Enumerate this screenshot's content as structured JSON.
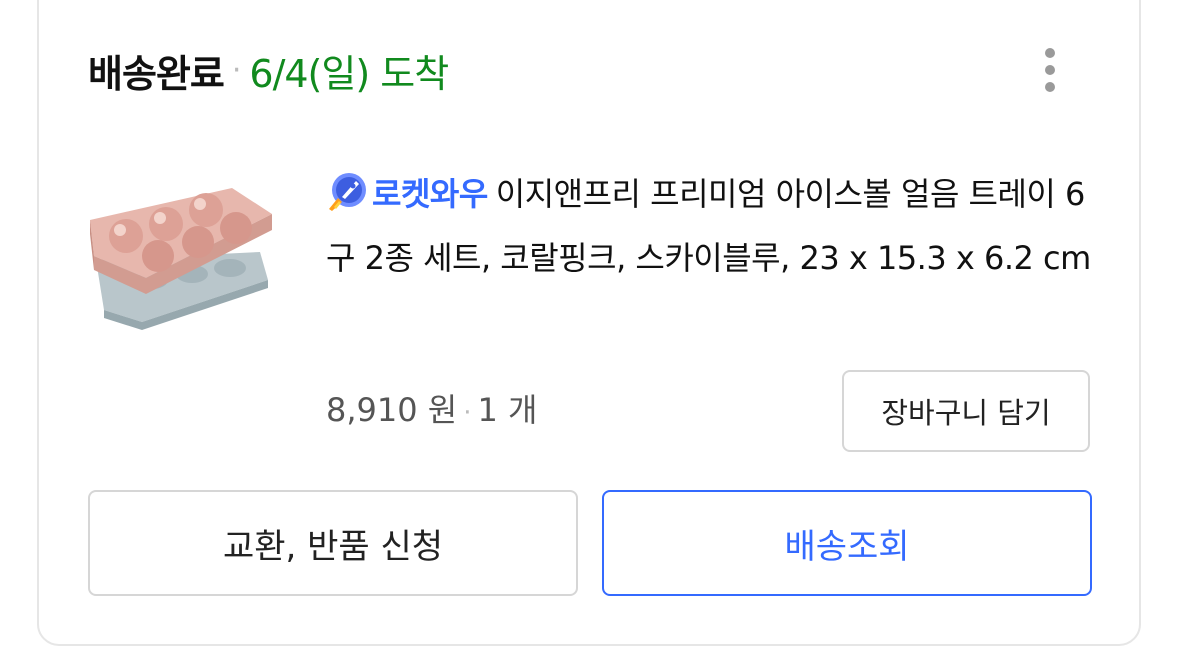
{
  "order": {
    "status": "배송완료",
    "separator": "·",
    "arrival": "6/4(일) 도착"
  },
  "product": {
    "badge_icon": "rocket-icon",
    "badge_label": "로켓와우",
    "title": "이지앤프리 프리미엄 아이스볼 얼음 트레이 6구 2종 세트, 코랄핑크, 스카이블루, 23 x 15.3 x 6.2 cm",
    "price": "8,910 원",
    "separator": "·",
    "quantity": "1 개",
    "image": "ice-ball-tray-image"
  },
  "buttons": {
    "add_to_cart": "장바구니 담기",
    "exchange_return": "교환, 반품 신청",
    "track_delivery": "배송조회"
  },
  "colors": {
    "status_green": "#118a1e",
    "accent_blue": "#346aff"
  }
}
